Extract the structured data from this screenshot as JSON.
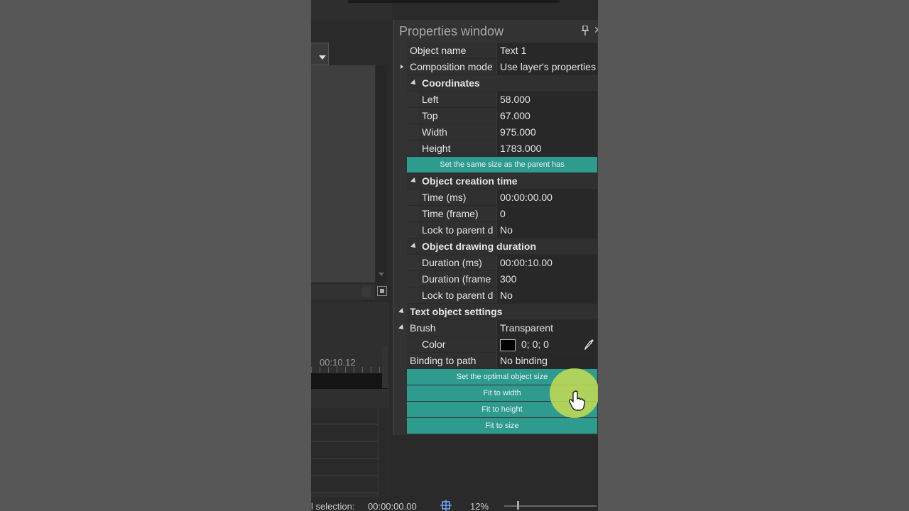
{
  "panel": {
    "title": "Properties window"
  },
  "rows": {
    "object_name": {
      "key": "Object name",
      "value": "Text 1"
    },
    "composition_mode": {
      "key": "Composition mode",
      "value": "Use layer's properties"
    }
  },
  "coordinates": {
    "header": "Coordinates",
    "left": {
      "key": "Left",
      "value": "58.000"
    },
    "top": {
      "key": "Top",
      "value": "67.000"
    },
    "width": {
      "key": "Width",
      "value": "975.000"
    },
    "height": {
      "key": "Height",
      "value": "1783.000"
    },
    "same_size_btn": "Set the same size as the parent has"
  },
  "creation_time": {
    "header": "Object creation time",
    "time_ms": {
      "key": "Time (ms)",
      "value": "00:00:00.00"
    },
    "time_frame": {
      "key": "Time (frame)",
      "value": "0"
    },
    "lock": {
      "key": "Lock to parent d",
      "value": "No"
    }
  },
  "drawing_duration": {
    "header": "Object drawing duration",
    "duration_ms": {
      "key": "Duration (ms)",
      "value": "00:00:10.00"
    },
    "duration_frame": {
      "key": "Duration (frame",
      "value": "300"
    },
    "lock": {
      "key": "Lock to parent d",
      "value": "No"
    }
  },
  "text_settings": {
    "header": "Text object settings",
    "brush": {
      "key": "Brush",
      "value": "Transparent"
    },
    "color": {
      "key": "Color",
      "value": "0; 0; 0",
      "swatch": "#000000"
    },
    "binding": {
      "key": "Binding to path",
      "value": "No binding"
    },
    "buttons": {
      "optimal": "Set the optimal object size",
      "fit_width": "Fit to width",
      "fit_height": "Fit to height",
      "fit_size": "Fit to size"
    }
  },
  "timeline": {
    "time_label": "00:10.12"
  },
  "status": {
    "selection_label": "l selection:",
    "selection_value": "00:00:00.00",
    "zoom": "12%"
  },
  "colors": {
    "accent": "#2f9a8e",
    "cursor_highlight": "#c6dc54"
  }
}
